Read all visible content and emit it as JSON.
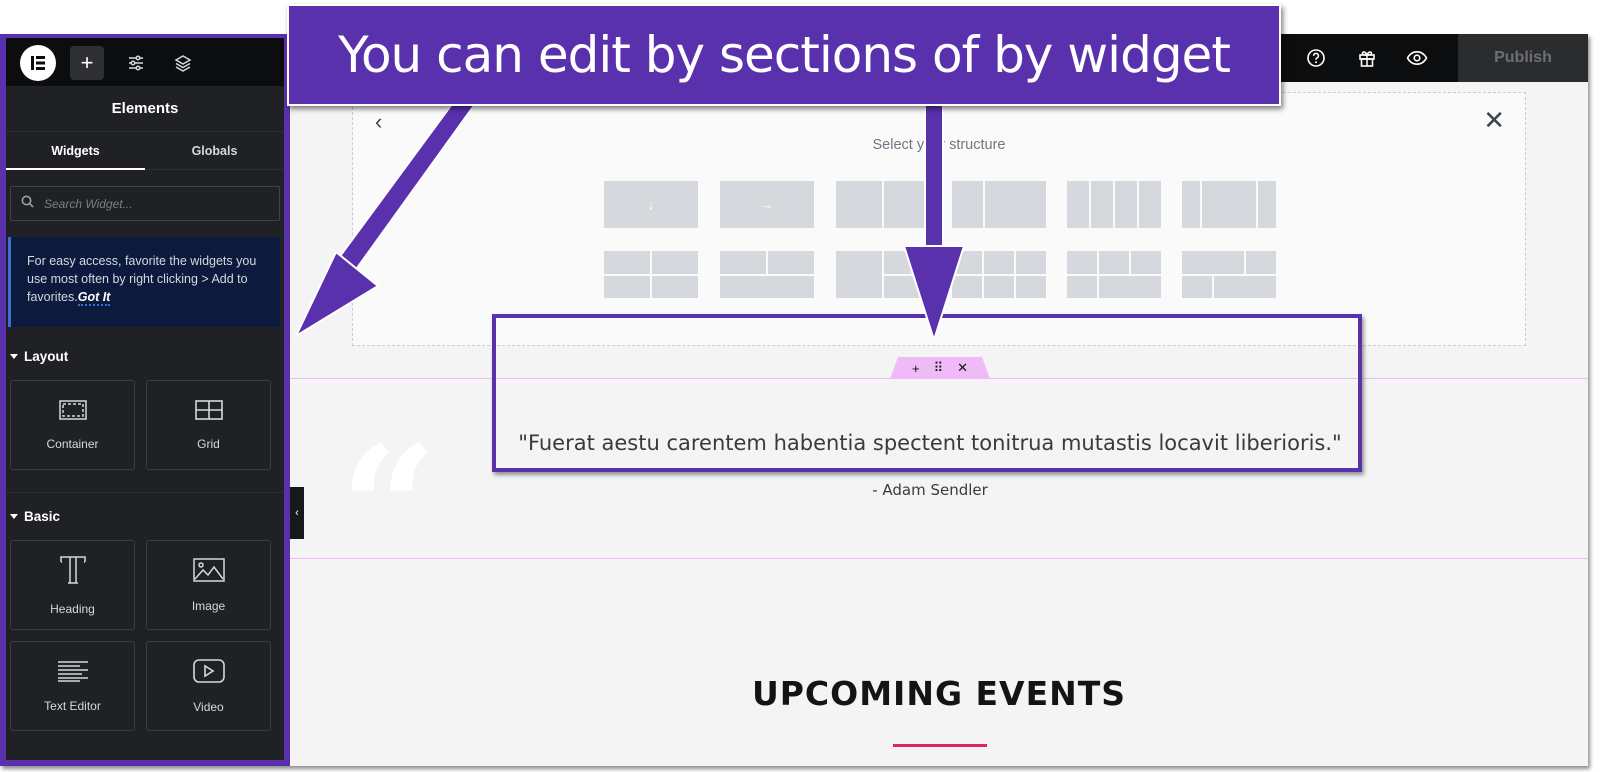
{
  "annotation": {
    "banner_text": "You can edit by sections of by widget",
    "color": "#5a31ac"
  },
  "topbar": {
    "icons": [
      "help-icon",
      "gift-icon",
      "preview-eye-icon"
    ],
    "publish_label": "Publish"
  },
  "sidebar": {
    "toolbar_icons": [
      "elementor-logo",
      "add-element-icon",
      "site-settings-icon",
      "structure-layers-icon"
    ],
    "add_symbol": "+",
    "panel_title": "Elements",
    "tabs": [
      {
        "label": "Widgets",
        "active": true
      },
      {
        "label": "Globals",
        "active": false
      }
    ],
    "search": {
      "placeholder": "Search Widget...",
      "value": ""
    },
    "tip": {
      "text": "For easy access, favorite the widgets you use most often by right clicking > Add to favorites.",
      "link": "Got It"
    },
    "categories": [
      {
        "title": "Layout",
        "widgets": [
          {
            "label": "Container",
            "icon": "container-icon"
          },
          {
            "label": "Grid",
            "icon": "grid-icon"
          }
        ]
      },
      {
        "title": "Basic",
        "widgets": [
          {
            "label": "Heading",
            "icon": "heading-icon"
          },
          {
            "label": "Image",
            "icon": "image-icon"
          },
          {
            "label": "Text Editor",
            "icon": "text-editor-icon"
          },
          {
            "label": "Video",
            "icon": "video-icon"
          }
        ]
      }
    ],
    "collapse_symbol": "‹"
  },
  "structure_picker": {
    "title": "Select your structure",
    "back_symbol": "‹",
    "close_symbol": "✕",
    "arrow_down": "↓",
    "arrow_right": "→"
  },
  "widget_handle": {
    "add": "+",
    "drag": "⠿",
    "remove": "✕"
  },
  "content": {
    "quote_mark": "“",
    "quote": "\"Fuerat aestu carentem habentia spectent tonitrua mutastis locavit liberioris.\"",
    "author": "- Adam Sendler",
    "events_heading": "UPCOMING EVENTS",
    "accent": "#e2245c"
  }
}
